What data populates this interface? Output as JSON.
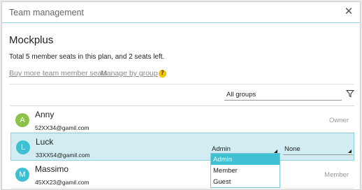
{
  "dialog": {
    "title": "Team management",
    "close_icon": "close-icon"
  },
  "team": {
    "name": "Mockplus",
    "seats_text": "Total 5 member seats in this plan, and 2 seats left."
  },
  "links": {
    "buy_seats": "Buy more team member seats",
    "manage_group": "Manage by group",
    "help_icon": "?"
  },
  "filter": {
    "group_value": "All groups",
    "filter_icon": "filter-icon"
  },
  "members": [
    {
      "initial": "A",
      "name": "Anny",
      "email": "52XX34@gamil.com",
      "role": "Owner",
      "avatar_color": "#8bc34a"
    },
    {
      "initial": "L",
      "name": "Luck",
      "email": "33XX54@gamil.com",
      "role_select": "Admin",
      "group_select": "None",
      "avatar_color": "#3ebfd2"
    },
    {
      "initial": "M",
      "name": "Massimo",
      "email": "45XX23@gamil.com",
      "role": "Member",
      "avatar_color": "#3ebfd2"
    }
  ],
  "role_dropdown": {
    "options": [
      "Admin",
      "Member",
      "Guest"
    ],
    "highlighted": "Admin"
  },
  "colors": {
    "accent": "#40c1d3",
    "selected_row": "#d2edf1",
    "help": "#f5c400"
  }
}
